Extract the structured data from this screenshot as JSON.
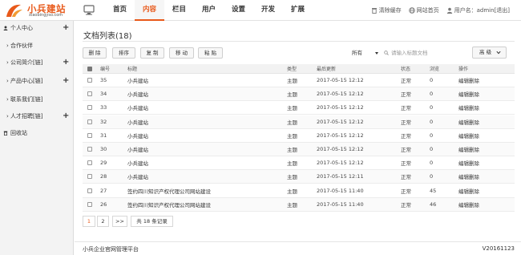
{
  "brand": {
    "title": "小兵建站",
    "subtitle": "xiaobingyso.com",
    "accent": "#e8591a"
  },
  "nav": [
    {
      "label": "首页",
      "active": false
    },
    {
      "label": "内容",
      "active": true
    },
    {
      "label": "栏目",
      "active": false
    },
    {
      "label": "用户",
      "active": false
    },
    {
      "label": "设置",
      "active": false
    },
    {
      "label": "开发",
      "active": false
    },
    {
      "label": "扩展",
      "active": false
    }
  ],
  "topright": {
    "clear_cache": "清除缓存",
    "site_home": "网站首页",
    "user": "用户名：admin",
    "logout": "[退出]"
  },
  "sidebar": {
    "items": [
      {
        "label": "个人中心",
        "plus": "+",
        "icon": "user-icon"
      },
      {
        "label": "合作伙伴",
        "plus": "",
        "icon": "arrow-icon"
      },
      {
        "label": "公司简介[链]",
        "plus": "+",
        "icon": "arrow-icon"
      },
      {
        "label": "产品中心[链]",
        "plus": "+",
        "icon": "arrow-icon"
      },
      {
        "label": "联系我们[链]",
        "plus": "",
        "icon": "arrow-icon"
      },
      {
        "label": "人才招聘[链]",
        "plus": "+",
        "icon": "arrow-icon"
      },
      {
        "label": "回收站",
        "plus": "",
        "icon": "trash-icon"
      }
    ]
  },
  "main": {
    "title": "文档列表(18)",
    "buttons": {
      "delete": "删 除",
      "sort": "排序",
      "copy": "复 制",
      "move": "移 动",
      "paste": "粘 贴",
      "advanced": "高 级"
    },
    "filter_select": "所有",
    "search_placeholder": "请输入标题文档"
  },
  "table": {
    "headers": [
      "编号",
      "标题",
      "类型",
      "最后更新",
      "状态",
      "浏览",
      "操作"
    ],
    "rows": [
      {
        "id": "35",
        "title": "小兵建站",
        "type": "主题",
        "updated": "2017-05-15 12:12",
        "status": "正常",
        "views": "0",
        "edit": "编辑",
        "del": "删除"
      },
      {
        "id": "34",
        "title": "小兵建站",
        "type": "主题",
        "updated": "2017-05-15 12:12",
        "status": "正常",
        "views": "0",
        "edit": "编辑",
        "del": "删除"
      },
      {
        "id": "33",
        "title": "小兵建站",
        "type": "主题",
        "updated": "2017-05-15 12:12",
        "status": "正常",
        "views": "0",
        "edit": "编辑",
        "del": "删除"
      },
      {
        "id": "32",
        "title": "小兵建站",
        "type": "主题",
        "updated": "2017-05-15 12:12",
        "status": "正常",
        "views": "0",
        "edit": "编辑",
        "del": "删除"
      },
      {
        "id": "31",
        "title": "小兵建站",
        "type": "主题",
        "updated": "2017-05-15 12:12",
        "status": "正常",
        "views": "0",
        "edit": "编辑",
        "del": "删除"
      },
      {
        "id": "30",
        "title": "小兵建站",
        "type": "主题",
        "updated": "2017-05-15 12:12",
        "status": "正常",
        "views": "0",
        "edit": "编辑",
        "del": "删除"
      },
      {
        "id": "29",
        "title": "小兵建站",
        "type": "主题",
        "updated": "2017-05-15 12:12",
        "status": "正常",
        "views": "0",
        "edit": "编辑",
        "del": "删除"
      },
      {
        "id": "28",
        "title": "小兵建站",
        "type": "主题",
        "updated": "2017-05-15 12:11",
        "status": "正常",
        "views": "0",
        "edit": "编辑",
        "del": "删除"
      },
      {
        "id": "27",
        "title": "签约四川知识产权代理公司网站建设",
        "type": "主题",
        "updated": "2017-05-15 11:40",
        "status": "正常",
        "views": "45",
        "edit": "编辑",
        "del": "删除"
      },
      {
        "id": "26",
        "title": "签约四川知识产权代理公司网站建设",
        "type": "主题",
        "updated": "2017-05-15 11:40",
        "status": "正常",
        "views": "46",
        "edit": "编辑",
        "del": "删除"
      }
    ]
  },
  "pagination": {
    "pages": [
      "1",
      "2"
    ],
    "next": ">>",
    "total": "共 18 条记录"
  },
  "footer": {
    "left": "小兵企业官网管理平台",
    "right": "V20161123"
  }
}
